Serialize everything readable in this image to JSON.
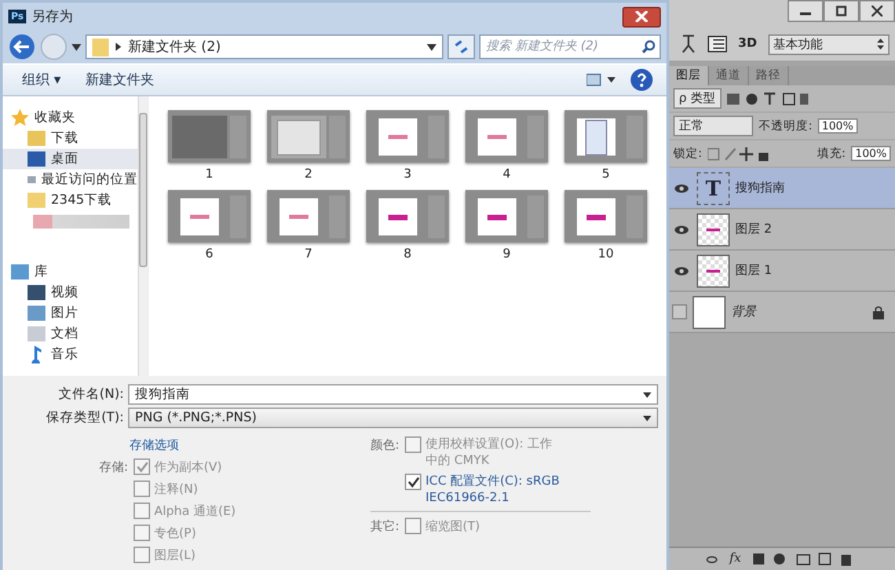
{
  "dialog": {
    "logo": "Ps",
    "title": "另存为",
    "address": "新建文件夹 (2)",
    "search": {
      "placeholder": "搜索 新建文件夹 (2)"
    },
    "toolbar": [
      "组织 ▾",
      "新建文件夹"
    ],
    "sidebar": [
      {
        "label": "收藏夹",
        "kind": "star",
        "selected": false
      },
      {
        "label": "下载",
        "kind": "download",
        "selected": false
      },
      {
        "label": "桌面",
        "kind": "desktop",
        "selected": true
      },
      {
        "label": "最近访问的位置",
        "kind": "recent",
        "selected": false
      },
      {
        "label": "2345下载",
        "kind": "folder",
        "selected": false
      },
      {
        "kind": "blurred",
        "selected": false
      },
      {
        "label": "库",
        "kind": "library",
        "selected": false
      },
      {
        "label": "视频",
        "kind": "video",
        "selected": false
      },
      {
        "label": "图片",
        "kind": "picture",
        "selected": false
      },
      {
        "label": "文档",
        "kind": "document",
        "selected": false
      },
      {
        "label": "音乐",
        "kind": "music",
        "selected": false
      }
    ],
    "files": [
      {
        "name": "1",
        "kind": "blank"
      },
      {
        "name": "2",
        "kind": "dialog"
      },
      {
        "name": "3",
        "kind": "text"
      },
      {
        "name": "4",
        "kind": "text"
      },
      {
        "name": "5",
        "kind": "menu"
      },
      {
        "name": "6",
        "kind": "text"
      },
      {
        "name": "7",
        "kind": "text"
      },
      {
        "name": "8",
        "kind": "bold"
      },
      {
        "name": "9",
        "kind": "bold"
      },
      {
        "name": "10",
        "kind": "bold"
      }
    ],
    "filename": {
      "label": "文件名(N):",
      "value": "搜狗指南"
    },
    "filetype": {
      "label": "保存类型(T):",
      "value": "PNG (*.PNG;*.PNS)"
    },
    "options_link": "存储选项",
    "save_label": "存储:",
    "save_options": [
      {
        "label": "作为副本(V)",
        "checked": true,
        "disabled": true
      },
      {
        "label": "注释(N)",
        "checked": false,
        "disabled": true
      },
      {
        "label": "Alpha 通道(E)",
        "checked": false,
        "disabled": true
      },
      {
        "label": "专色(P)",
        "checked": false,
        "disabled": true
      },
      {
        "label": "图层(L)",
        "checked": false,
        "disabled": true
      }
    ],
    "color_label": "颜色:",
    "color_options": [
      {
        "label": "使用校样设置(O): 工作中的 CMYK",
        "checked": false,
        "disabled": true
      },
      {
        "label": "ICC 配置文件(C): sRGB IEC61966-2.1",
        "checked": true,
        "disabled": false
      }
    ],
    "other_label": "其它:",
    "other_options": [
      {
        "label": "缩览图(T)",
        "checked": false,
        "disabled": true
      }
    ]
  },
  "photoshop": {
    "label_3d": "3D",
    "workspace": "基本功能",
    "fx": "fx",
    "tabs": [
      {
        "label": "图层",
        "selected": true
      },
      {
        "label": "通道",
        "selected": false
      },
      {
        "label": "路径",
        "selected": false
      }
    ],
    "filter": "ρ 类型",
    "blend": "正常",
    "opacity_label": "不透明度:",
    "opacity": "100%",
    "lock_label": "锁定:",
    "fill_label": "填充:",
    "fill": "100%",
    "layers": [
      {
        "name": "搜狗指南",
        "kind": "text",
        "glyph": "T",
        "visible": true,
        "selected": true,
        "locked": false
      },
      {
        "name": "图层 2",
        "kind": "pixel",
        "visible": true,
        "selected": false,
        "locked": false
      },
      {
        "name": "图层 1",
        "kind": "pixel",
        "visible": true,
        "selected": false,
        "locked": false
      },
      {
        "name": "背景",
        "kind": "background",
        "visible": false,
        "selected": false,
        "locked": true
      }
    ]
  }
}
